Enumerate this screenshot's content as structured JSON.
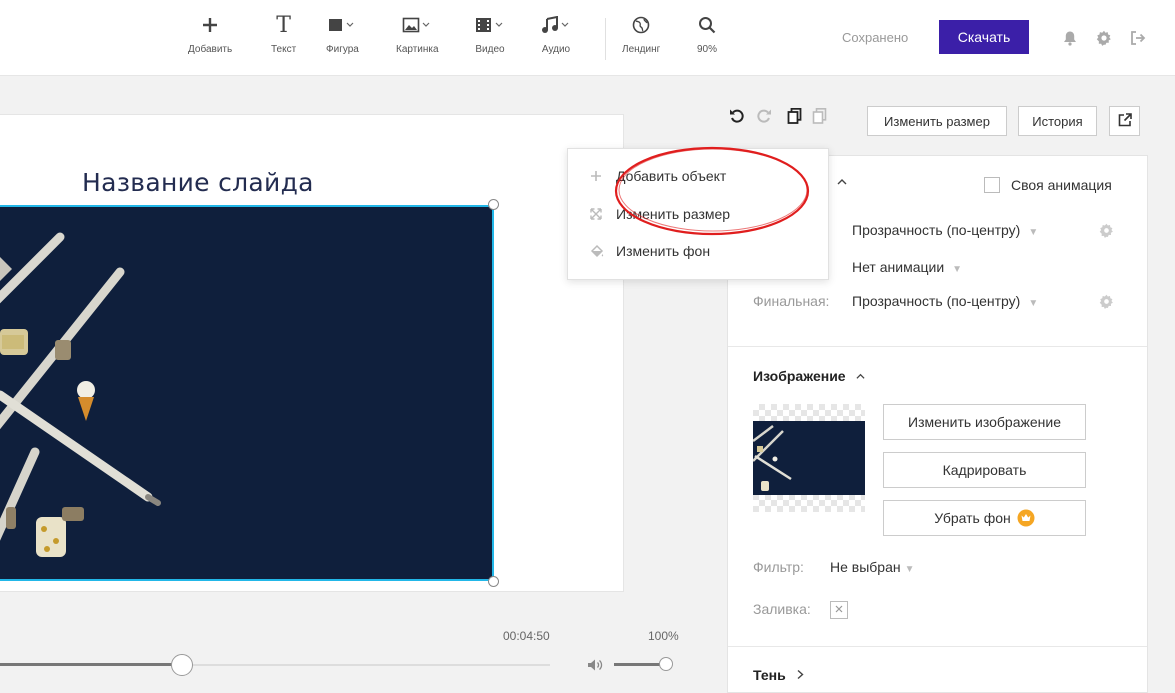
{
  "toolbar": {
    "tools": [
      {
        "label": "Добавить",
        "icon": "plus-icon"
      },
      {
        "label": "Текст",
        "icon": "text-icon"
      },
      {
        "label": "Фигура",
        "icon": "shape-icon"
      },
      {
        "label": "Картинка",
        "icon": "image-icon"
      },
      {
        "label": "Видео",
        "icon": "video-icon"
      },
      {
        "label": "Аудио",
        "icon": "audio-icon"
      },
      {
        "label": "Лендинг",
        "icon": "globe-icon"
      },
      {
        "label": "90%",
        "icon": "zoom-icon"
      }
    ],
    "saved_status": "Сохранено",
    "download_label": "Скачать",
    "accent_color": "#3b1fa8"
  },
  "slide": {
    "title": "Название слайда",
    "selection_color": "#22b7e8"
  },
  "context_menu": {
    "items": [
      {
        "label": "Добавить объект",
        "icon": "plus-icon"
      },
      {
        "label": "Изменить размер",
        "icon": "resize-icon"
      },
      {
        "label": "Изменить фон",
        "icon": "paint-bucket-icon"
      }
    ]
  },
  "edit_bar": {
    "resize_label": "Изменить размер",
    "history_label": "История"
  },
  "animation": {
    "custom_animation_label": "Своя анимация",
    "entrance_value": "Прозрачность (по-центру)",
    "middle_value": "Нет анимации",
    "final_label": "Финальная:",
    "final_value": "Прозрачность (по-центру)"
  },
  "image_section": {
    "heading": "Изображение",
    "change_image_label": "Изменить изображение",
    "crop_label": "Кадрировать",
    "remove_bg_label": "Убрать фон",
    "filter_label": "Фильтр:",
    "filter_value": "Не выбран",
    "fill_label": "Заливка:"
  },
  "shadow_section": {
    "heading": "Тень"
  },
  "timeline": {
    "time": "00:04:50",
    "volume": "100%",
    "progress": 0.33,
    "volume_level": 1.0
  }
}
